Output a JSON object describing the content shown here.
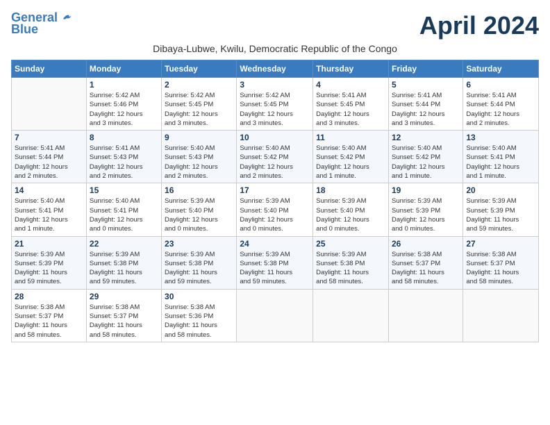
{
  "header": {
    "logo_line1": "General",
    "logo_line2": "Blue",
    "month_title": "April 2024",
    "subtitle": "Dibaya-Lubwe, Kwilu, Democratic Republic of the Congo"
  },
  "weekdays": [
    "Sunday",
    "Monday",
    "Tuesday",
    "Wednesday",
    "Thursday",
    "Friday",
    "Saturday"
  ],
  "weeks": [
    [
      {
        "day": "",
        "info": ""
      },
      {
        "day": "1",
        "info": "Sunrise: 5:42 AM\nSunset: 5:46 PM\nDaylight: 12 hours\nand 3 minutes."
      },
      {
        "day": "2",
        "info": "Sunrise: 5:42 AM\nSunset: 5:45 PM\nDaylight: 12 hours\nand 3 minutes."
      },
      {
        "day": "3",
        "info": "Sunrise: 5:42 AM\nSunset: 5:45 PM\nDaylight: 12 hours\nand 3 minutes."
      },
      {
        "day": "4",
        "info": "Sunrise: 5:41 AM\nSunset: 5:45 PM\nDaylight: 12 hours\nand 3 minutes."
      },
      {
        "day": "5",
        "info": "Sunrise: 5:41 AM\nSunset: 5:44 PM\nDaylight: 12 hours\nand 3 minutes."
      },
      {
        "day": "6",
        "info": "Sunrise: 5:41 AM\nSunset: 5:44 PM\nDaylight: 12 hours\nand 2 minutes."
      }
    ],
    [
      {
        "day": "7",
        "info": "Sunrise: 5:41 AM\nSunset: 5:44 PM\nDaylight: 12 hours\nand 2 minutes."
      },
      {
        "day": "8",
        "info": "Sunrise: 5:41 AM\nSunset: 5:43 PM\nDaylight: 12 hours\nand 2 minutes."
      },
      {
        "day": "9",
        "info": "Sunrise: 5:40 AM\nSunset: 5:43 PM\nDaylight: 12 hours\nand 2 minutes."
      },
      {
        "day": "10",
        "info": "Sunrise: 5:40 AM\nSunset: 5:42 PM\nDaylight: 12 hours\nand 2 minutes."
      },
      {
        "day": "11",
        "info": "Sunrise: 5:40 AM\nSunset: 5:42 PM\nDaylight: 12 hours\nand 1 minute."
      },
      {
        "day": "12",
        "info": "Sunrise: 5:40 AM\nSunset: 5:42 PM\nDaylight: 12 hours\nand 1 minute."
      },
      {
        "day": "13",
        "info": "Sunrise: 5:40 AM\nSunset: 5:41 PM\nDaylight: 12 hours\nand 1 minute."
      }
    ],
    [
      {
        "day": "14",
        "info": "Sunrise: 5:40 AM\nSunset: 5:41 PM\nDaylight: 12 hours\nand 1 minute."
      },
      {
        "day": "15",
        "info": "Sunrise: 5:40 AM\nSunset: 5:41 PM\nDaylight: 12 hours\nand 0 minutes."
      },
      {
        "day": "16",
        "info": "Sunrise: 5:39 AM\nSunset: 5:40 PM\nDaylight: 12 hours\nand 0 minutes."
      },
      {
        "day": "17",
        "info": "Sunrise: 5:39 AM\nSunset: 5:40 PM\nDaylight: 12 hours\nand 0 minutes."
      },
      {
        "day": "18",
        "info": "Sunrise: 5:39 AM\nSunset: 5:40 PM\nDaylight: 12 hours\nand 0 minutes."
      },
      {
        "day": "19",
        "info": "Sunrise: 5:39 AM\nSunset: 5:39 PM\nDaylight: 12 hours\nand 0 minutes."
      },
      {
        "day": "20",
        "info": "Sunrise: 5:39 AM\nSunset: 5:39 PM\nDaylight: 11 hours\nand 59 minutes."
      }
    ],
    [
      {
        "day": "21",
        "info": "Sunrise: 5:39 AM\nSunset: 5:39 PM\nDaylight: 11 hours\nand 59 minutes."
      },
      {
        "day": "22",
        "info": "Sunrise: 5:39 AM\nSunset: 5:38 PM\nDaylight: 11 hours\nand 59 minutes."
      },
      {
        "day": "23",
        "info": "Sunrise: 5:39 AM\nSunset: 5:38 PM\nDaylight: 11 hours\nand 59 minutes."
      },
      {
        "day": "24",
        "info": "Sunrise: 5:39 AM\nSunset: 5:38 PM\nDaylight: 11 hours\nand 59 minutes."
      },
      {
        "day": "25",
        "info": "Sunrise: 5:39 AM\nSunset: 5:38 PM\nDaylight: 11 hours\nand 58 minutes."
      },
      {
        "day": "26",
        "info": "Sunrise: 5:38 AM\nSunset: 5:37 PM\nDaylight: 11 hours\nand 58 minutes."
      },
      {
        "day": "27",
        "info": "Sunrise: 5:38 AM\nSunset: 5:37 PM\nDaylight: 11 hours\nand 58 minutes."
      }
    ],
    [
      {
        "day": "28",
        "info": "Sunrise: 5:38 AM\nSunset: 5:37 PM\nDaylight: 11 hours\nand 58 minutes."
      },
      {
        "day": "29",
        "info": "Sunrise: 5:38 AM\nSunset: 5:37 PM\nDaylight: 11 hours\nand 58 minutes."
      },
      {
        "day": "30",
        "info": "Sunrise: 5:38 AM\nSunset: 5:36 PM\nDaylight: 11 hours\nand 58 minutes."
      },
      {
        "day": "",
        "info": ""
      },
      {
        "day": "",
        "info": ""
      },
      {
        "day": "",
        "info": ""
      },
      {
        "day": "",
        "info": ""
      }
    ]
  ]
}
